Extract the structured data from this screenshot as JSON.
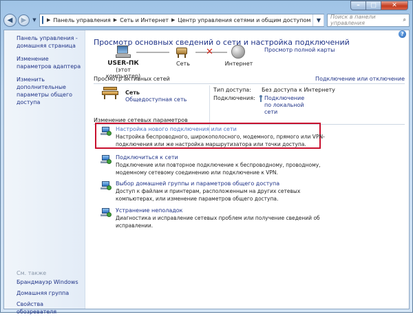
{
  "window": {
    "breadcrumbs": [
      "Панель управления",
      "Сеть и Интернет",
      "Центр управления сетями и общим доступом"
    ],
    "search_placeholder": "Поиск в панели управления"
  },
  "sidebar": {
    "links": [
      "Панель управления - домашняя страница",
      "Изменение параметров адаптера",
      "Изменить дополнительные параметры общего доступа"
    ],
    "see_also": "См. также",
    "bottom_links": [
      "Брандмауэр Windows",
      "Домашняя группа",
      "Свойства обозревателя"
    ]
  },
  "main": {
    "title": "Просмотр основных сведений о сети и настройка подключений",
    "full_map_link": "Просмотр полной карты",
    "map": {
      "computer_name": "USER-ПК",
      "computer_sub": "(этот компьютер)",
      "network_label": "Сеть",
      "internet_label": "Интернет"
    },
    "active_networks_title": "Просмотр активных сетей",
    "connect_disconnect_link": "Подключение или отключение",
    "network": {
      "name": "Сеть",
      "type_link": "Общедоступная сеть",
      "access_type_key": "Тип доступа:",
      "access_type_value": "Без доступа к Интернету",
      "connections_key": "Подключения:",
      "connections_value": "Подключение по локальной сети"
    },
    "change_title": "Изменение сетевых параметров",
    "tasks": [
      {
        "link": "Настройка нового подключения или сети",
        "desc": "Настройка беспроводного, широкополосного, модемного, прямого или VPN-подключения или же настройка маршрутизатора или точки доступа."
      },
      {
        "link": "Подключиться к сети",
        "desc": "Подключение или повторное подключение к беспроводному, проводному, модемному сетевому соединению или подключение к VPN."
      },
      {
        "link": "Выбор домашней группы и параметров общего доступа",
        "desc": "Доступ к файлам и принтерам, расположенным на других сетевых компьютерах, или изменение параметров общего доступа."
      },
      {
        "link": "Устранение неполадок",
        "desc": "Диагностика и исправление сетевых проблем или получение сведений об исправлении."
      }
    ]
  },
  "colors": {
    "link": "#1e3287",
    "highlight_border": "#c8102e"
  },
  "icons": [
    "back-icon",
    "forward-icon",
    "control-panel-icon",
    "refresh-icon",
    "search-icon",
    "help-icon",
    "computer-icon",
    "network-icon",
    "globe-icon",
    "bench-icon",
    "task-network-icon"
  ]
}
